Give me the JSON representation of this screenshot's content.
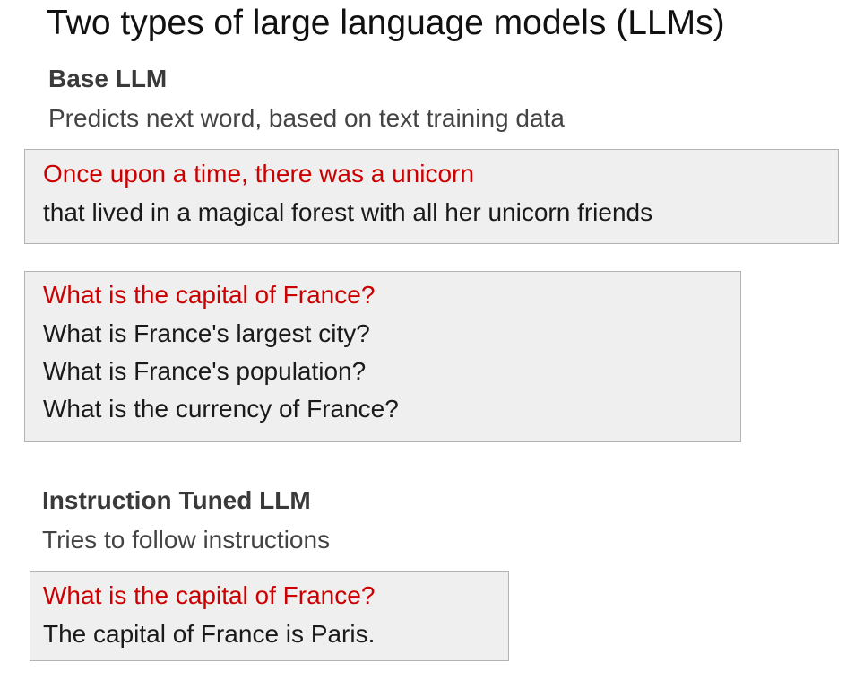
{
  "title": "Two types of large language models (LLMs)",
  "base_llm": {
    "heading": "Base LLM",
    "description": "Predicts next word, based on text training data",
    "example1": {
      "prompt": "Once upon a time, there was a unicorn",
      "completion": "that lived in a magical forest with all her unicorn friends"
    },
    "example2": {
      "prompt": "What is the capital of France?",
      "completions": [
        "What is France's largest city?",
        "What is France's population?",
        "What is the currency of France?"
      ]
    }
  },
  "instruction_tuned_llm": {
    "heading": "Instruction Tuned LLM",
    "description": "Tries to follow instructions",
    "example": {
      "prompt": "What is the capital of France?",
      "completion": "The capital of France is Paris."
    }
  },
  "colors": {
    "prompt": "#cc0000",
    "completion": "#1a1a1a",
    "box_background": "#efefef",
    "box_border": "#b3b3b3"
  }
}
